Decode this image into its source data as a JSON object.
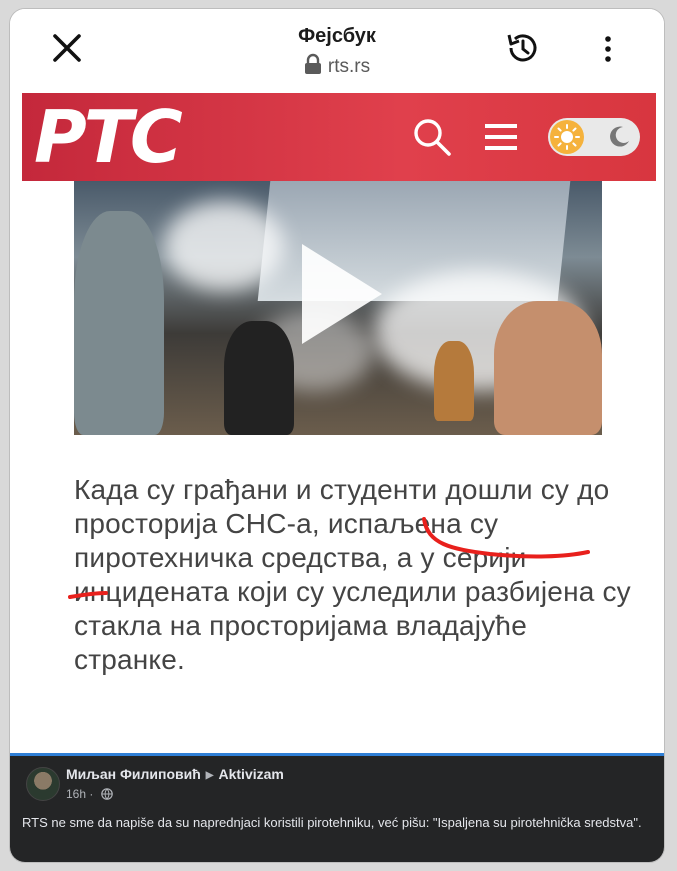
{
  "browser": {
    "title": "Фејсбук",
    "url": "rts.rs",
    "close_icon": "close-icon",
    "history_icon": "history-icon",
    "more_icon": "more-vertical-icon"
  },
  "site_header": {
    "logo_text": "РТС",
    "search_icon": "search-icon",
    "menu_icon": "hamburger-menu-icon",
    "theme_toggle": {
      "state": "light",
      "sun_icon": "sun-icon",
      "moon_icon": "moon-icon"
    },
    "color": "#d8363f"
  },
  "video": {
    "play_icon": "play-icon"
  },
  "article": {
    "text": "Када су грађани и студенти дошли су до просторија СНС-а, испаљена су  пиротехничка средства, а у серији инцидената који су уследили разбијена су стакла на просторијама владајуће странке."
  },
  "post": {
    "author": "Миљан Филиповић",
    "group": "Aktivizam",
    "time": "16h",
    "audience_icon": "globe-icon",
    "body": "RTS ne sme da napiše da su naprednjaci koristili pirotehniku, već pišu: \"Ispaljena su pirotehnička sredstva\"."
  },
  "colors": {
    "annotation": "#e8201c",
    "divider": "#2f7fd6",
    "post_background": "#242526"
  }
}
